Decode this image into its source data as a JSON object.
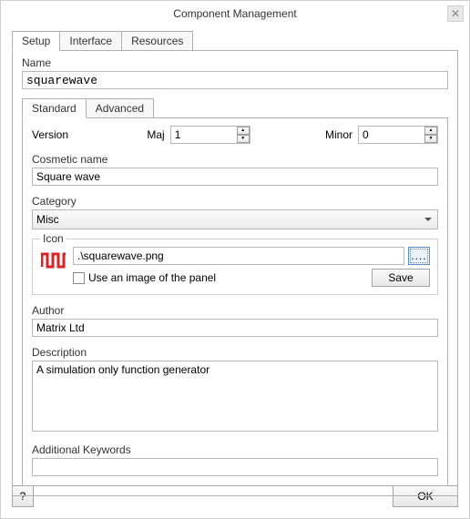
{
  "window": {
    "title": "Component Management",
    "close_glyph": "✕"
  },
  "tabs": {
    "setup": "Setup",
    "interface": "Interface",
    "resources": "Resources"
  },
  "name": {
    "label": "Name",
    "value": "squarewave"
  },
  "inner_tabs": {
    "standard": "Standard",
    "advanced": "Advanced"
  },
  "version": {
    "label": "Version",
    "maj_label": "Maj",
    "maj_value": "1",
    "minor_label": "Minor",
    "minor_value": "0"
  },
  "cosmetic": {
    "label": "Cosmetic name",
    "value": "Square wave"
  },
  "category": {
    "label": "Category",
    "value": "Misc"
  },
  "icon": {
    "label": "Icon",
    "path": ".\\squarewave.png",
    "browse_glyph": "....",
    "checkbox_label": "Use an image of the panel",
    "save_label": "Save"
  },
  "author": {
    "label": "Author",
    "value": "Matrix Ltd"
  },
  "description": {
    "label": "Description",
    "value": "A simulation only function generator"
  },
  "keywords": {
    "label": "Additional Keywords",
    "value": ""
  },
  "footer": {
    "help": "?",
    "ok": "OK"
  }
}
